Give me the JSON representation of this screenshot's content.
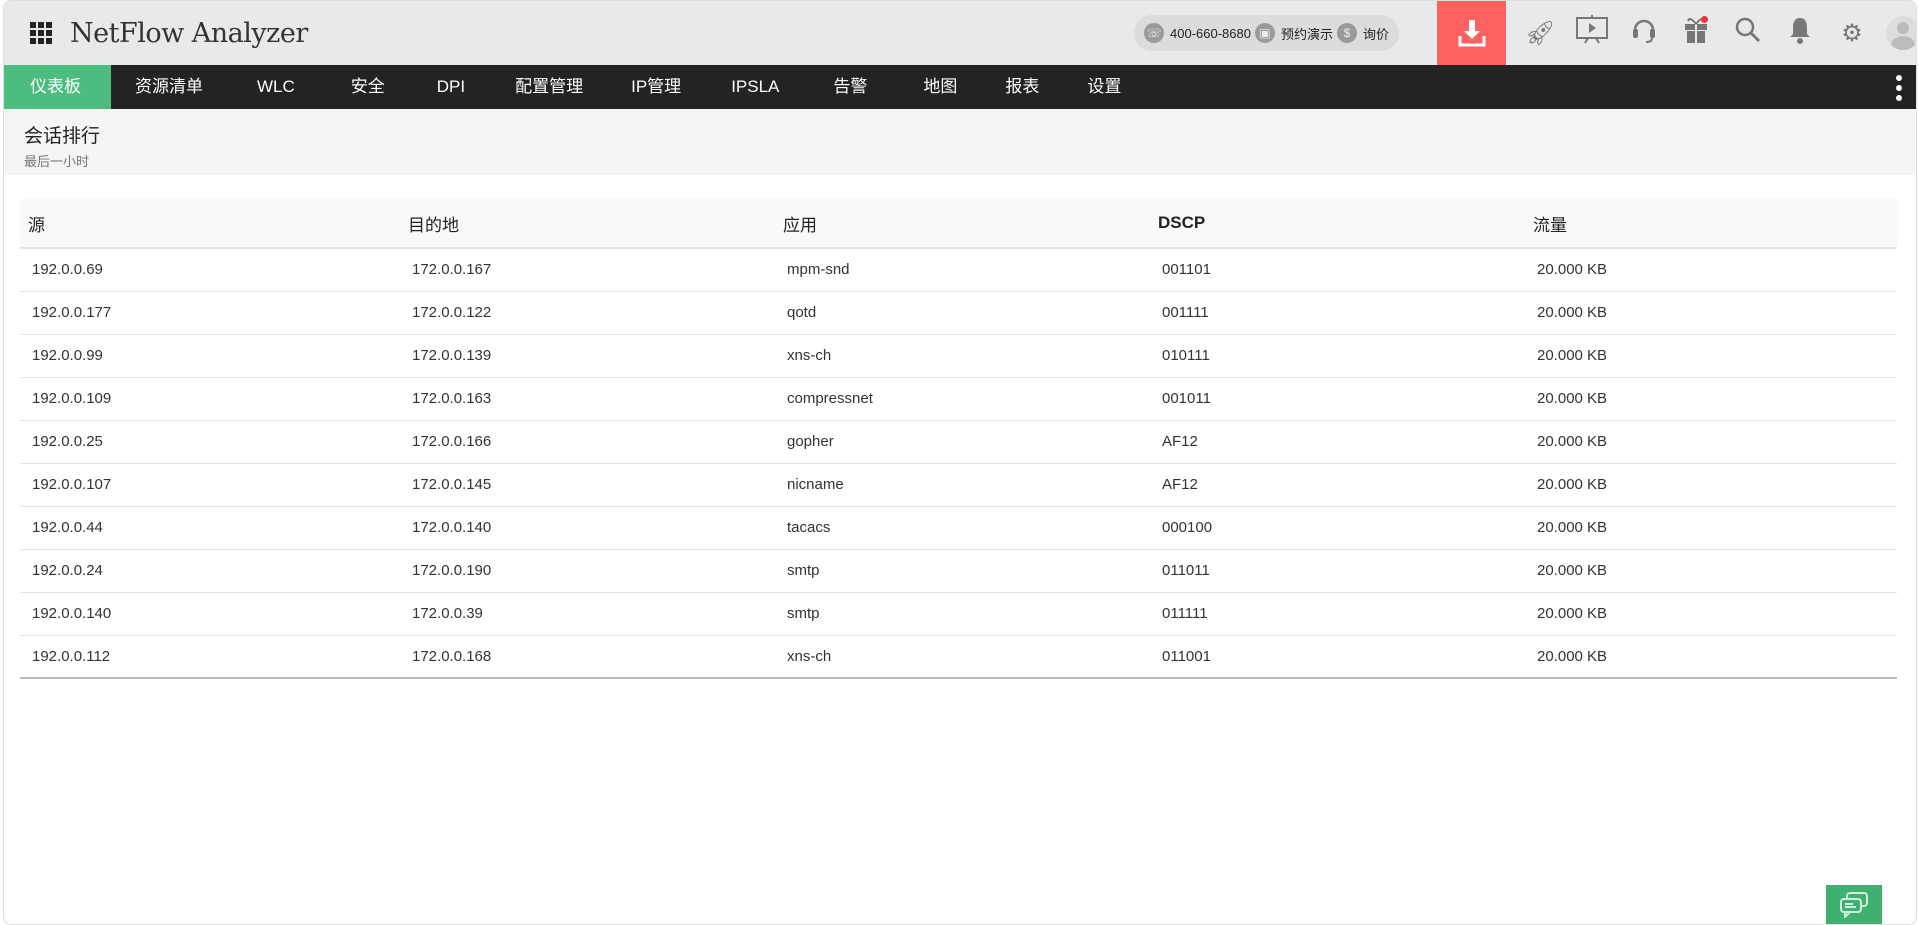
{
  "header": {
    "app_title": "NetFlow Analyzer",
    "phone": "400-660-8680",
    "demo": "预约演示",
    "price": "询价"
  },
  "nav": {
    "items": [
      "仪表板",
      "资源清单",
      "WLC",
      "安全",
      "DPI",
      "配置管理",
      "IP管理",
      "IPSLA",
      "告警",
      "地图",
      "报表",
      "设置"
    ],
    "active": 0
  },
  "page": {
    "title": "会话排行",
    "subtitle": "最后一小时"
  },
  "table": {
    "headers": [
      "源",
      "目的地",
      "应用",
      "DSCP",
      "流量"
    ],
    "rows": [
      [
        "192.0.0.69",
        "172.0.0.167",
        "mpm-snd",
        "001101",
        "20.000 KB"
      ],
      [
        "192.0.0.177",
        "172.0.0.122",
        "qotd",
        "001111",
        "20.000 KB"
      ],
      [
        "192.0.0.99",
        "172.0.0.139",
        "xns-ch",
        "010111",
        "20.000 KB"
      ],
      [
        "192.0.0.109",
        "172.0.0.163",
        "compressnet",
        "001011",
        "20.000 KB"
      ],
      [
        "192.0.0.25",
        "172.0.0.166",
        "gopher",
        "AF12",
        "20.000 KB"
      ],
      [
        "192.0.0.107",
        "172.0.0.145",
        "nicname",
        "AF12",
        "20.000 KB"
      ],
      [
        "192.0.0.44",
        "172.0.0.140",
        "tacacs",
        "000100",
        "20.000 KB"
      ],
      [
        "192.0.0.24",
        "172.0.0.190",
        "smtp",
        "011011",
        "20.000 KB"
      ],
      [
        "192.0.0.140",
        "172.0.0.39",
        "smtp",
        "011111",
        "20.000 KB"
      ],
      [
        "192.0.0.112",
        "172.0.0.168",
        "xns-ch",
        "011001",
        "20.000 KB"
      ]
    ]
  },
  "colors": {
    "accent": "#4cbd7f",
    "download": "#ff6161",
    "nav_bg": "#232323",
    "chat": "#3fb070"
  }
}
